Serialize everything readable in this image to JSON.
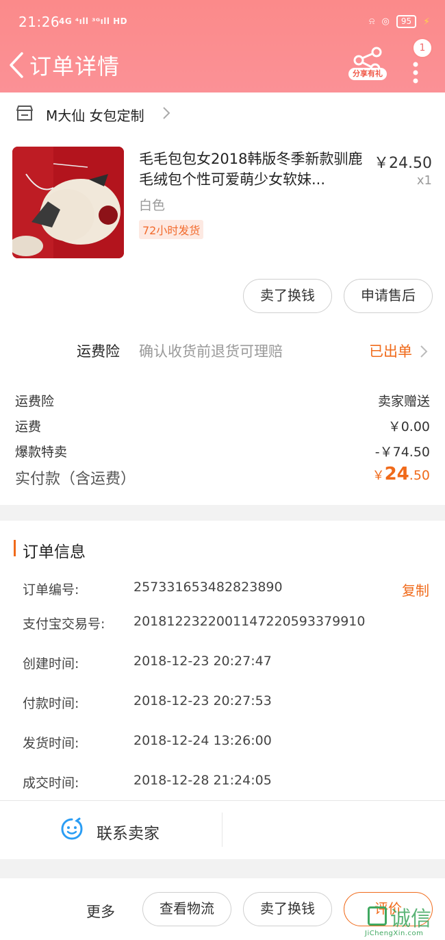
{
  "status_bar": {
    "time": "21:26",
    "network": "4G ⁴ıll ³ᴳıll HD",
    "battery": "95"
  },
  "nav": {
    "title": "订单详情",
    "share_label": "分享有礼",
    "notification_count": "1"
  },
  "shop": {
    "name": "M大仙 女包定制"
  },
  "product": {
    "title": "毛毛包包女2018韩版冬季新款驯鹿毛绒包个性可爱萌少女软妹...",
    "price": "￥24.50",
    "quantity": "x1",
    "sku": "白色",
    "tag": "72小时发货",
    "buttons": [
      "卖了换钱",
      "申请售后"
    ]
  },
  "insurance": {
    "label": "运费险",
    "description": "确认收货前退货可理赔",
    "status": "已出单"
  },
  "fees": [
    {
      "label": "运费险",
      "value": "卖家赠送"
    },
    {
      "label": "运费",
      "value": "￥0.00"
    },
    {
      "label": "爆款特卖",
      "value": "-￥74.50"
    }
  ],
  "total": {
    "label": "实付款（含运费）",
    "currency": "￥",
    "integer": "24",
    "decimal": ".50"
  },
  "order_info": {
    "title": "订单信息",
    "copy_label": "复制",
    "rows": [
      {
        "label": "订单编号:",
        "value": "257331653482823890"
      },
      {
        "label": "支付宝交易号:",
        "value": "2018122322001147220593379910"
      },
      {
        "label": "创建时间:",
        "value": "2018-12-23 20:27:47"
      },
      {
        "label": "付款时间:",
        "value": "2018-12-23 20:27:53"
      },
      {
        "label": "发货时间:",
        "value": "2018-12-24 13:26:00"
      },
      {
        "label": "成交时间:",
        "value": "2018-12-28 21:24:05"
      }
    ]
  },
  "contact": {
    "label": "联系卖家"
  },
  "bottom_bar": {
    "more": "更多",
    "buttons": [
      "查看物流",
      "卖了换钱",
      "评价"
    ]
  },
  "watermark": {
    "text": "诚信",
    "sub": "JiChengXin.com"
  },
  "colors": {
    "header": "#fb8a8a",
    "accent": "#f06a1a"
  }
}
